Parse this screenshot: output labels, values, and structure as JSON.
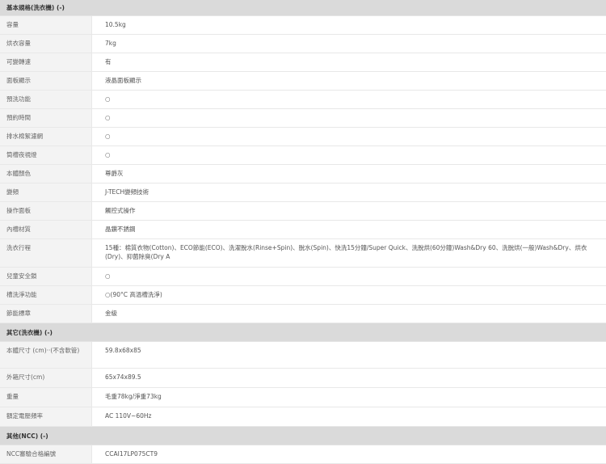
{
  "sections": [
    {
      "title": "基本規格(洗衣機) (-)",
      "rows": [
        {
          "label": "容量",
          "value": "10.5kg"
        },
        {
          "label": "烘衣容量",
          "value": "7kg"
        },
        {
          "label": "可變轉速",
          "value": "有"
        },
        {
          "label": "面板顯示",
          "value": "液晶面板顯示"
        },
        {
          "label": "預洗功能",
          "value": "○"
        },
        {
          "label": "預約時間",
          "value": "○"
        },
        {
          "label": "排水棉絮濾網",
          "value": "○"
        },
        {
          "label": "筒槽夜視燈",
          "value": "○"
        },
        {
          "label": "本體顏色",
          "value": "尊爵灰"
        },
        {
          "label": "變頻",
          "value": "J-TECH變頻技術"
        },
        {
          "label": "操作面板",
          "value": "觸控式操作"
        },
        {
          "label": "內槽材質",
          "value": "晶鑽不銹鋼"
        },
        {
          "label": "洗衣行程",
          "value": "15種：棉質衣物(Cotton)、ECO節能(ECO)、洗濯脫水(Rinse+Spin)、脫水(Spin)、快洗15分鐘/Super Quick、洗脫烘(60分鐘)Wash&Dry 60、洗脫烘(一般)Wash&Dry、烘衣(Dry)、抑菌除臭(Dry A"
        },
        {
          "label": "兒童安全鎖",
          "value": "○"
        },
        {
          "label": "槽洗淨功能",
          "value": "○(90°C 高溫槽洗淨)"
        },
        {
          "label": "節能標章",
          "value": "金級"
        }
      ]
    },
    {
      "title": "其它(洗衣機) (-)",
      "rows": [
        {
          "label": "本體尺寸 (cm)‧‧(不含軟管)",
          "value": "59.8x68x85"
        },
        {
          "label": "外箱尺寸(cm)",
          "value": "65x74x89.5"
        },
        {
          "label": "重量",
          "value": "毛重78kg/淨重73kg"
        },
        {
          "label": "額定電壓頻率",
          "value": "AC 110V~60Hz"
        }
      ]
    },
    {
      "title": "其他(NCC) (-)",
      "rows": [
        {
          "label": "NCC審驗合格編號",
          "value": "CCAI17LP075CT9"
        }
      ]
    }
  ]
}
